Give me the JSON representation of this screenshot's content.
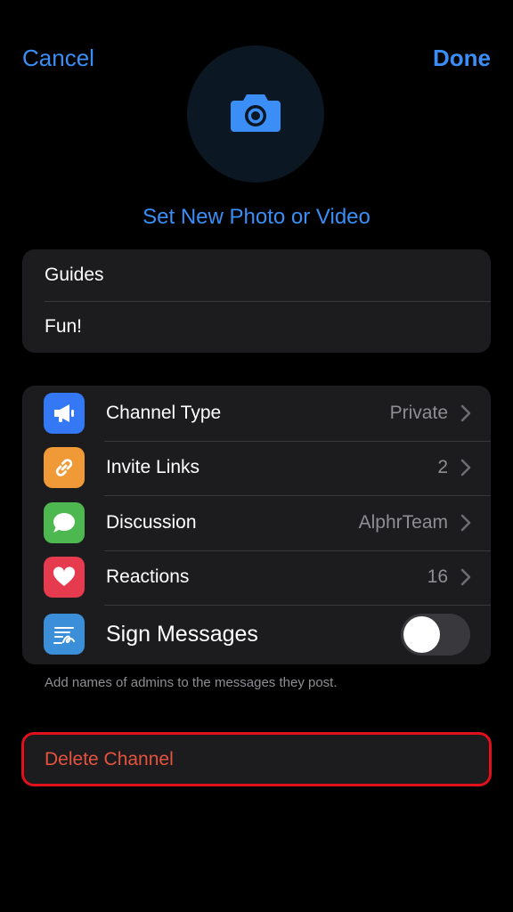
{
  "nav": {
    "cancel_label": "Cancel",
    "done_label": "Done"
  },
  "photo": {
    "icon": "camera-icon",
    "set_label": "Set New Photo or Video"
  },
  "channel": {
    "name": "Guides",
    "description": "Fun!"
  },
  "settings": [
    {
      "label": "Channel Type",
      "value": "Private",
      "icon": "megaphone-icon",
      "color": "#3478f6"
    },
    {
      "label": "Invite Links",
      "value": "2",
      "icon": "link-icon",
      "color": "#f09a37"
    },
    {
      "label": "Discussion",
      "value": "AlphrTeam",
      "icon": "speech-bubble-icon",
      "color": "#4cb84f"
    },
    {
      "label": "Reactions",
      "value": "16",
      "icon": "heart-icon",
      "color": "#e63a4e"
    },
    {
      "label": "Sign Messages",
      "icon": "signature-icon",
      "color": "#3a8fd8",
      "toggle_on": false
    }
  ],
  "footnote": "Add names of admins to the messages they post.",
  "delete_label": "Delete Channel",
  "colors": {
    "accent": "#3a8ef6",
    "danger": "#e5533f",
    "highlight": "#e0101c"
  }
}
